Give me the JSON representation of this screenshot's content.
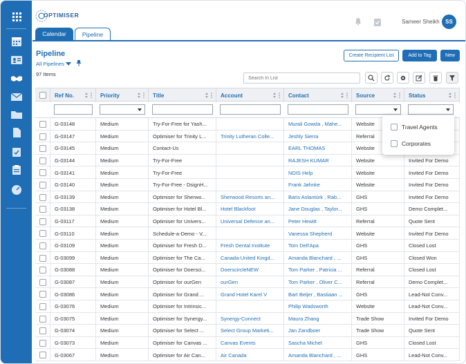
{
  "app": {
    "logo_text": "OPTIMISER",
    "user_name": "Sameer Sheikh",
    "user_initials": "SS"
  },
  "tabs": [
    {
      "label": "Calendar"
    },
    {
      "label": "Pipeline"
    }
  ],
  "page": {
    "title": "Pipeline",
    "filter_label": "All Pipelines",
    "item_count": "97 Items"
  },
  "toolbar": {
    "create_recipient_list": "Create Recipient List",
    "add_to_tag": "Add to Tag",
    "new": "New",
    "search_placeholder": "Search In List"
  },
  "columns": [
    "Ref No.",
    "Priority",
    "Title",
    "Account",
    "Contact",
    "Source",
    "Status"
  ],
  "source_options": [
    "Travel Agents",
    "Corporates"
  ],
  "rows": [
    {
      "ref": "G-03148",
      "priority": "Medium",
      "title": "Try-For-Free for Yash...",
      "account": "",
      "contact": "Murali Gowda , Mahe...",
      "source": "Website",
      "status": ""
    },
    {
      "ref": "G-03147",
      "priority": "Medium",
      "title": "Optimiser for Trinity L...",
      "account": "Trinity Lutheran Colle...",
      "contact": "Jeshly Sierra",
      "source": "Referral",
      "status": ""
    },
    {
      "ref": "G-03145",
      "priority": "Medium",
      "title": "Contact-Us",
      "account": "",
      "contact": "EARL THOMAS",
      "source": "Website",
      "status": ""
    },
    {
      "ref": "G-03144",
      "priority": "Medium",
      "title": "Try-For-Free",
      "account": "",
      "contact": "RAJESH KUMAR",
      "source": "Website",
      "status": "Invited For Demo"
    },
    {
      "ref": "G-03141",
      "priority": "Medium",
      "title": "Try-For-Free",
      "account": "",
      "contact": "NDIS Help",
      "source": "Website",
      "status": "Invited For Demo"
    },
    {
      "ref": "G-03140",
      "priority": "Medium",
      "title": "Try-For-Free - DsignH...",
      "account": "",
      "contact": "Frank Jøhnke",
      "source": "Website",
      "status": "Invited For Demo"
    },
    {
      "ref": "G-03139",
      "priority": "Medium",
      "title": "Optimiser for Sherwo...",
      "account": "Sherwood Resorts an...",
      "contact": "Baris Aslantürk , Rab...",
      "source": "GHS",
      "status": "Invited For Demo"
    },
    {
      "ref": "G-03138",
      "priority": "Medium",
      "title": "Optimiser for Hotel Bl...",
      "account": "Hotel Blackfoot",
      "contact": "Jane Douglas , Taylor...",
      "source": "GHS",
      "status": "Demo Complet..."
    },
    {
      "ref": "G-03117",
      "priority": "Medium",
      "title": "Optimiser for Univers...",
      "account": "Universal Defence an...",
      "contact": "Peter Hewitt",
      "source": "Referral",
      "status": "Quote Sent"
    },
    {
      "ref": "G-03110",
      "priority": "Medium",
      "title": "Schedule-a-Demo - V...",
      "account": "",
      "contact": "Vanessa Shepherd",
      "source": "Website",
      "status": "Invited For Demo"
    },
    {
      "ref": "G-03109",
      "priority": "Medium",
      "title": "Optimiser for Fresh D...",
      "account": "Fresh Dental Institute",
      "contact": "Tom Dell'Apa",
      "source": "GHS",
      "status": "Closed Lost"
    },
    {
      "ref": "G-03099",
      "priority": "Medium",
      "title": "Optimiser for The Ca...",
      "account": "Canada-United Kingd...",
      "contact": "Amanda Blanchard , ...",
      "source": "GHS",
      "status": "Closed Won"
    },
    {
      "ref": "G-03088",
      "priority": "Medium",
      "title": "Optimiser for Doersci...",
      "account": "DoerscircleNEW",
      "contact": "Tom Parker , Patricia ...",
      "source": "Referral",
      "status": "Closed Lost"
    },
    {
      "ref": "G-03087",
      "priority": "Medium",
      "title": "Optimiser for ourGen",
      "account": "ourGen",
      "contact": "Tom Parker , Oliver C...",
      "source": "Referral",
      "status": "Demo Complet..."
    },
    {
      "ref": "G-03086",
      "priority": "Medium",
      "title": "Optimiser for Grand ...",
      "account": "Grand Hotel Karel V",
      "contact": "Bart Beljer , Bastiaan ...",
      "source": "GHS",
      "status": "Lead-Not Conv..."
    },
    {
      "ref": "G-03076",
      "priority": "Medium",
      "title": "Optimiser for Intrinsic...",
      "account": "",
      "contact": "Philip Wadsworth",
      "source": "Website",
      "status": "Lead-Not Conv..."
    },
    {
      "ref": "G-03075",
      "priority": "Medium",
      "title": "Optimiser for Synergy...",
      "account": "Synergy-Connect",
      "contact": "Maura Zhang",
      "source": "Trade Show",
      "status": "Invited For Demo"
    },
    {
      "ref": "G-03074",
      "priority": "Medium",
      "title": "Optimiser for Select ...",
      "account": "Select Group Marketi...",
      "contact": "Jan Zandboer",
      "source": "Trade Show",
      "status": "Quote Sent"
    },
    {
      "ref": "G-03073",
      "priority": "Medium",
      "title": "Optimiser for Canvas ...",
      "account": "Canvas Events",
      "contact": "Sascha Michel",
      "source": "GHS",
      "status": "Closed Lost"
    },
    {
      "ref": "G-03067",
      "priority": "Medium",
      "title": "Optimiser for Air Can...",
      "account": "Air Canada",
      "contact": "Amanda Blanchard , ...",
      "source": "GHS",
      "status": "Lead-Not Conv..."
    }
  ]
}
